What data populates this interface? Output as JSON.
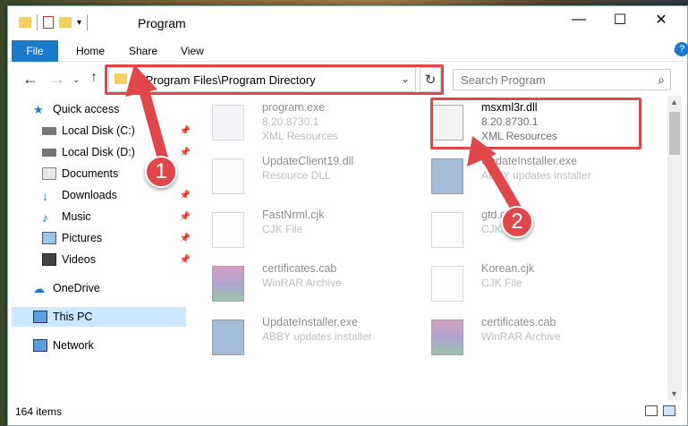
{
  "window": {
    "title": "Program"
  },
  "ribbon": {
    "file": "File",
    "home": "Home",
    "share": "Share",
    "view": "View"
  },
  "address": {
    "path": "C:\\Program Files\\Program Directory"
  },
  "search": {
    "placeholder": "Search Program"
  },
  "sidebar": {
    "items": [
      {
        "label": "Quick access"
      },
      {
        "label": "Local Disk (C:)"
      },
      {
        "label": "Local Disk (D:)"
      },
      {
        "label": "Documents"
      },
      {
        "label": "Downloads"
      },
      {
        "label": "Music"
      },
      {
        "label": "Pictures"
      },
      {
        "label": "Videos"
      },
      {
        "label": "OneDrive"
      },
      {
        "label": "This PC"
      },
      {
        "label": "Network"
      }
    ]
  },
  "files": [
    {
      "name": "program.exe",
      "sub1": "8.20.8730.1",
      "sub2": "XML Resources"
    },
    {
      "name": "msxml3r.dll",
      "sub1": "8.20.8730.1",
      "sub2": "XML Resources"
    },
    {
      "name": "UpdateClient19.dll",
      "sub1": "Resource DLL",
      "sub2": ""
    },
    {
      "name": "UpdateInstaller.exe",
      "sub1": "ABBY updates installer",
      "sub2": ""
    },
    {
      "name": "FastNrml.cjk",
      "sub1": "CJK File",
      "sub2": ""
    },
    {
      "name": "gtd.cjk",
      "sub1": "CJK File",
      "sub2": ""
    },
    {
      "name": "certificates.cab",
      "sub1": "WinRAR Archive",
      "sub2": ""
    },
    {
      "name": "Korean.cjk",
      "sub1": "CJK File",
      "sub2": ""
    },
    {
      "name": "UpdateInstaller.exe",
      "sub1": "ABBY updates installer",
      "sub2": ""
    },
    {
      "name": "certificates.cab",
      "sub1": "WinRAR Archive",
      "sub2": ""
    }
  ],
  "status": {
    "count": "164 items"
  },
  "steps": {
    "one": "1",
    "two": "2"
  }
}
